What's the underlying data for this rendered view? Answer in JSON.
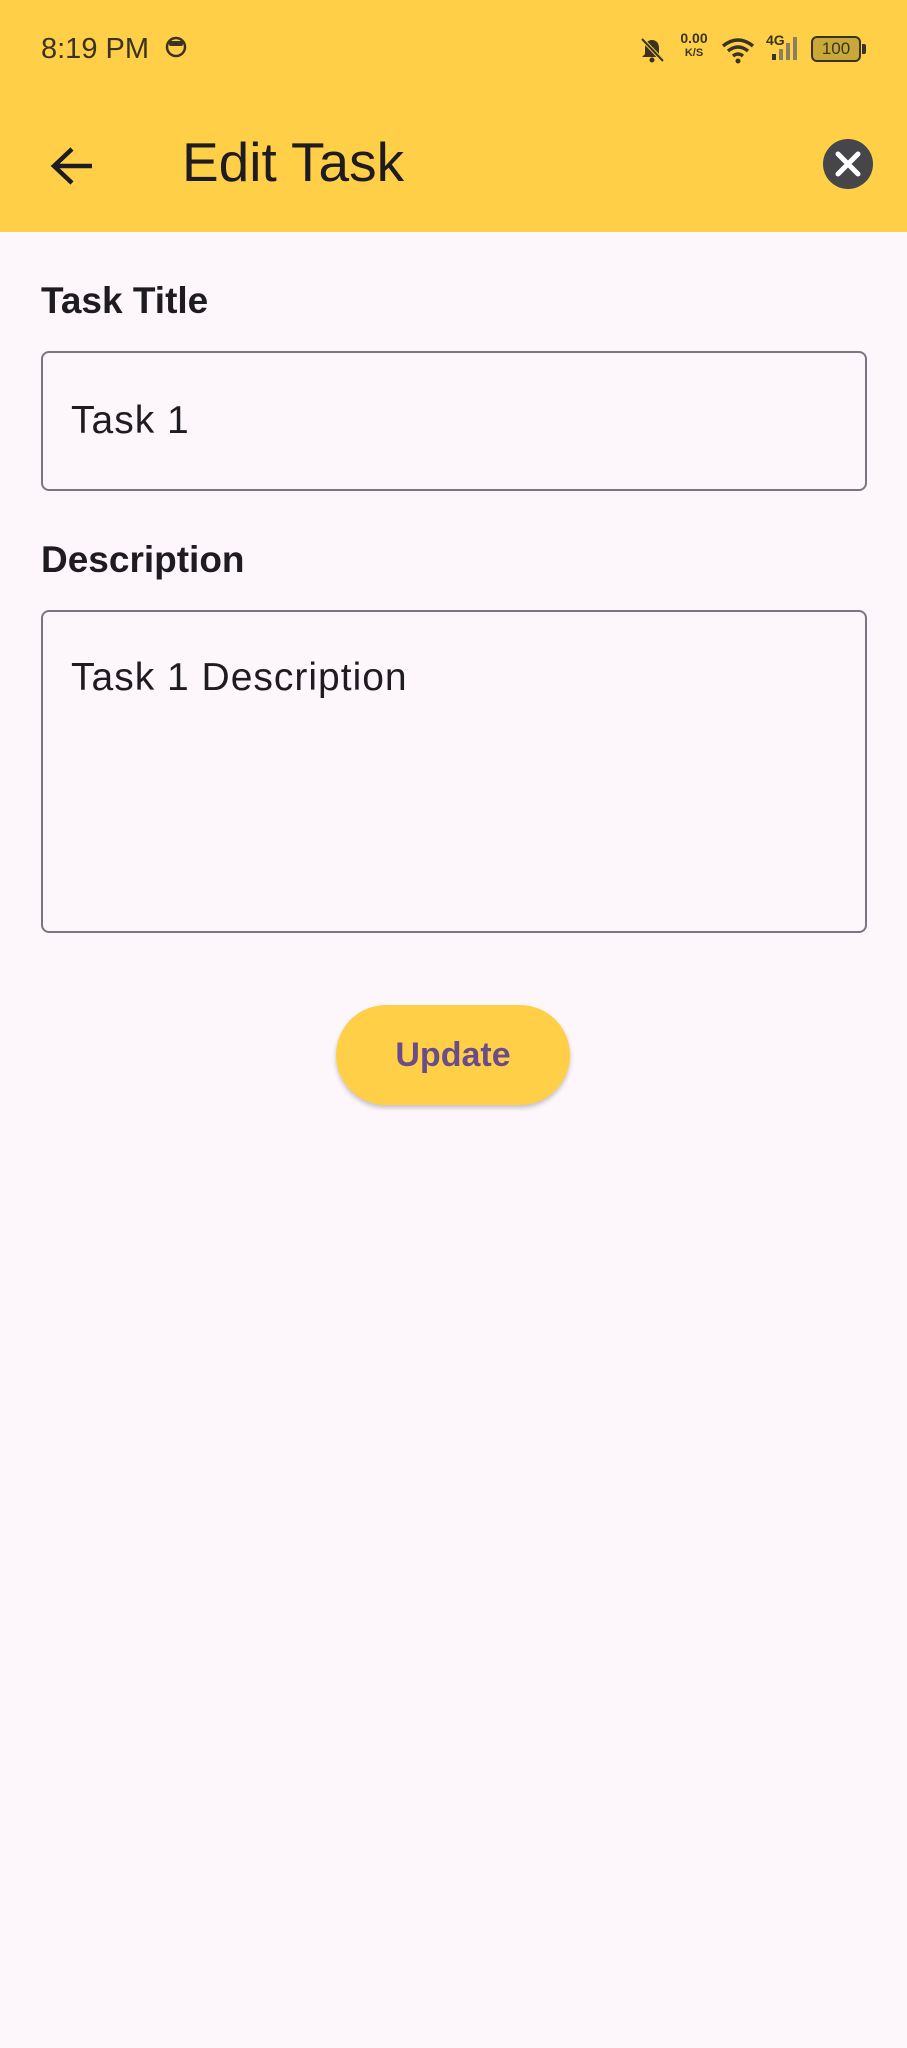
{
  "status_bar": {
    "time": "8:19 PM",
    "net_speed_value": "0.00",
    "net_speed_unit": "K/S",
    "network_type": "4G",
    "battery": "100"
  },
  "app_bar": {
    "title": "Edit Task",
    "back_icon": "arrow-left-icon",
    "close_icon": "close-circle-icon"
  },
  "form": {
    "title_label": "Task Title",
    "title_value": "Task 1",
    "description_label": "Description",
    "description_value": "Task 1 Description",
    "submit_label": "Update"
  },
  "colors": {
    "accent": "#ffd047",
    "background": "#fdf7fc",
    "button_text": "#6a4c8a"
  }
}
